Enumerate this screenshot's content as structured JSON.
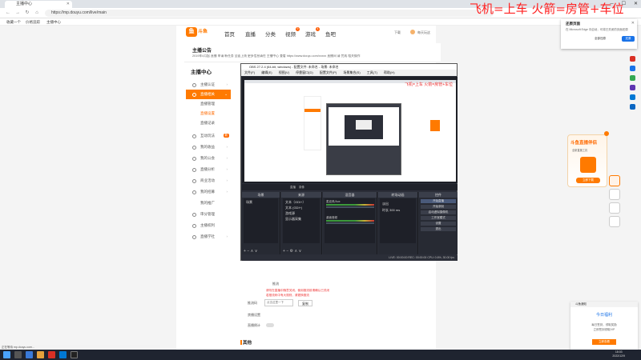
{
  "browser": {
    "tab_title": "主播中心",
    "url": "https://mp.douyu.com/live/main",
    "favorites": [
      "收藏一个",
      "价格追踪",
      "主播中心"
    ]
  },
  "site": {
    "logo_text": "斗鱼",
    "nav": [
      {
        "label": "首页"
      },
      {
        "label": "直播"
      },
      {
        "label": "分类"
      },
      {
        "label": "视频",
        "badge": "9"
      },
      {
        "label": "游戏",
        "badge": "4"
      },
      {
        "label": "鱼吧"
      }
    ],
    "header_right": [
      "下载",
      "每天玩这"
    ]
  },
  "notice": {
    "title": "主播公告",
    "text": "2019年4月起 直播 申请 新任务 全面上线 更多信息请在 主播中心 查看 https://www.douyu.com/xxxxx 直播间 请 完成 相关操作"
  },
  "sidebar": {
    "title": "主播中心",
    "items": [
      {
        "label": "主播认证",
        "type": "item"
      },
      {
        "label": "直播相关",
        "type": "active"
      },
      {
        "label": "直播管理",
        "type": "plain"
      },
      {
        "label": "直播设置",
        "type": "sub"
      },
      {
        "label": "直播记录",
        "type": "plain"
      },
      {
        "label": "互动玩法",
        "type": "item",
        "tag": "新"
      },
      {
        "label": "我的收益",
        "type": "item"
      },
      {
        "label": "我的公会",
        "type": "item"
      },
      {
        "label": "直播分析",
        "type": "item"
      },
      {
        "label": "商业活动",
        "type": "item"
      },
      {
        "label": "我的招募",
        "type": "item"
      },
      {
        "label": "我的推广",
        "type": "item"
      },
      {
        "label": "审分管理",
        "type": "item"
      },
      {
        "label": "主播权利",
        "type": "item"
      },
      {
        "label": "直播学社",
        "type": "item"
      }
    ]
  },
  "obs": {
    "title": "OBS 27.2.4 (64-bit, windows) - 配置文件: 未命名 - 场景: 未命名",
    "menu": [
      "文件(F)",
      "编辑(E)",
      "视图(V)",
      "停靠窗口(D)",
      "配置文件(P)",
      "场景集合(S)",
      "工具(T)",
      "帮助(H)"
    ],
    "inner_red_text": "飞机=上车 火箭=房管+车位",
    "status_strip": [
      "直播",
      "录像"
    ],
    "docks": [
      {
        "header": "场景",
        "items": [
          "场景"
        ]
      },
      {
        "header": "来源",
        "items": [
          "文本（GDI+）",
          "文本 (GDI+)",
          "游戏源",
          "显示器采集"
        ]
      },
      {
        "header": "混音器",
        "items": [
          "麦克风/Aux",
          "桌面音频"
        ]
      },
      {
        "header": "转场动画",
        "items": [
          "淡出",
          "时长 300 ms"
        ]
      },
      {
        "header": "控件",
        "items": [
          "开始直播",
          "开始录制",
          "启动虚拟摄像机",
          "工作室模式",
          "设置",
          "退出"
        ]
      }
    ],
    "bottom_status": "LIVE: 00:00:00   REC: 00:00:00   CPU: 0.6%, 30.00 fps"
  },
  "below": {
    "item1": "推流",
    "red1": "请勿在直播中随意关闭，使用推流前请确认已关闭",
    "red2": "若推流码中有大规则，请更换推流",
    "code_label": "推流码",
    "code_placeholder": "点击这里一下",
    "copy_btn": "复制",
    "label2": "禁播设置",
    "label3": "直播倒计",
    "other_title": "其他"
  },
  "overlay_text": "飞机=上车 火箭=房管+车位",
  "popup": {
    "title": "还原页面",
    "text": "在 Microsoft Edge 中启动，可将已关闭的页面还原",
    "secondary": "全部还原",
    "primary": "还原"
  },
  "promo": {
    "title": "斗鱼直播伴侣",
    "text": "全新直播工具",
    "button": "立即下载"
  },
  "notice2": {
    "header": "斗鱼通知",
    "title": "今日福利",
    "line1": "每日签到，领取奖励",
    "line2": "立即签到领取VIP",
    "button": "立即查看"
  },
  "statusbar": "正在等待 mp.douyu.com...",
  "clock": {
    "time": "18:03",
    "date": "2022/12/9"
  }
}
